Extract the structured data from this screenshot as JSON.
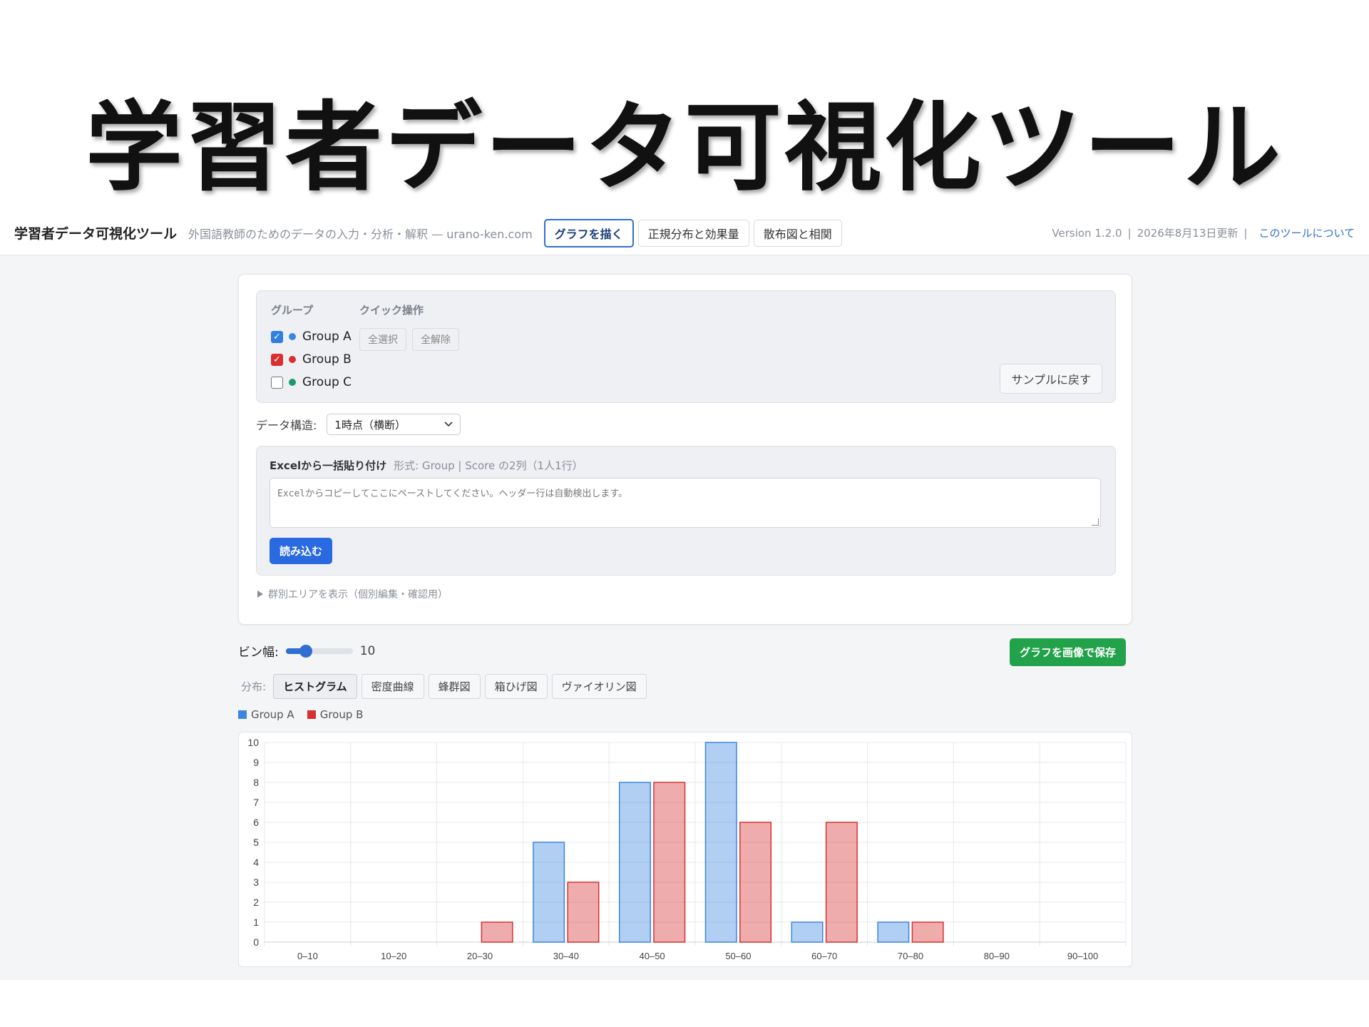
{
  "hero": {
    "title": "学習者データ可視化ツール"
  },
  "header": {
    "app_title": "学習者データ可視化ツール",
    "subtitle": "外国語教師のためのデータの入力・分析・解釈 — urano-ken.com",
    "tabs": [
      {
        "label": "グラフを描く",
        "active": true
      },
      {
        "label": "正規分布と効果量",
        "active": false
      },
      {
        "label": "散布図と相関",
        "active": false
      }
    ],
    "version": "Version 1.2.0",
    "updated": "2026年8月13日更新",
    "about_link": "このツールについて"
  },
  "groups_panel": {
    "group_heading": "グループ",
    "quick_heading": "クイック操作",
    "groups": [
      {
        "name": "Group A",
        "checked": true,
        "color": "#3a86e0"
      },
      {
        "name": "Group B",
        "checked": true,
        "color": "#d83030"
      },
      {
        "name": "Group C",
        "checked": false,
        "color": "#1a9a6a"
      }
    ],
    "select_all": "全選択",
    "clear_all": "全解除",
    "reset_label": "サンプルに戻す"
  },
  "data_structure": {
    "label": "データ構造:",
    "selected": "1時点（横断）"
  },
  "paste": {
    "title": "Excelから一括貼り付け",
    "format_hint": "形式: Group | Score の2列（1人1行）",
    "placeholder": "Excelからコピーしてここにペーストしてください。ヘッダー行は自動検出します。",
    "load_label": "読み込む"
  },
  "expand_label": "群別エリアを表示（個別編集・確認用）",
  "bin": {
    "label": "ビン幅:",
    "value": "10",
    "level": 0.3
  },
  "save_label": "グラフを画像で保存",
  "distribution": {
    "label": "分布:",
    "tabs": [
      {
        "label": "ヒストグラム",
        "active": true
      },
      {
        "label": "密度曲線",
        "active": false
      },
      {
        "label": "蜂群図",
        "active": false
      },
      {
        "label": "箱ひげ図",
        "active": false
      },
      {
        "label": "ヴァイオリン図",
        "active": false
      }
    ]
  },
  "chart_data": {
    "type": "bar",
    "categories": [
      "0–10",
      "10–20",
      "20–30",
      "30–40",
      "40–50",
      "50–60",
      "60–70",
      "70–80",
      "80–90",
      "90–100"
    ],
    "series": [
      {
        "name": "Group A",
        "values": [
          0,
          0,
          0,
          5,
          8,
          10,
          1,
          1,
          0,
          0
        ],
        "color": "#3a86e0"
      },
      {
        "name": "Group B",
        "values": [
          0,
          0,
          1,
          3,
          8,
          6,
          6,
          1,
          0,
          0
        ],
        "color": "#d83030"
      }
    ],
    "ylim": [
      0,
      10
    ],
    "yticks": [
      0,
      1,
      2,
      3,
      4,
      5,
      6,
      7,
      8,
      9,
      10
    ],
    "grid": true,
    "legend": "top-left"
  }
}
